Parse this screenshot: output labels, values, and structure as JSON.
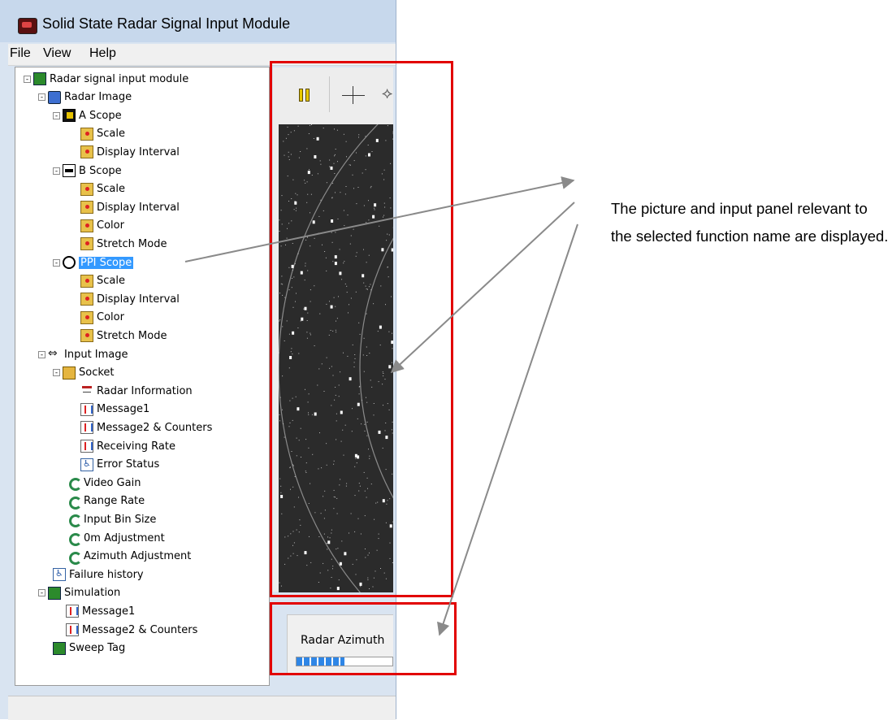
{
  "window": {
    "title": "Solid State Radar Signal Input Module"
  },
  "menu": [
    "File",
    "View",
    "Help"
  ],
  "tree": [
    {
      "label": "Radar signal input module",
      "icon": "module-icon",
      "expander": "-"
    },
    {
      "label": "Radar Image",
      "icon": "monitor-icon",
      "expander": "-"
    },
    {
      "label": "A Scope",
      "icon": "a-scope-icon",
      "expander": "-"
    },
    {
      "label": "Scale",
      "icon": "folder-icon"
    },
    {
      "label": "Display Interval",
      "icon": "folder-icon"
    },
    {
      "label": "B Scope",
      "icon": "b-scope-icon",
      "expander": "-"
    },
    {
      "label": "Scale",
      "icon": "folder-icon"
    },
    {
      "label": "Display Interval",
      "icon": "folder-icon"
    },
    {
      "label": "Color",
      "icon": "folder-icon"
    },
    {
      "label": "Stretch Mode",
      "icon": "folder-icon"
    },
    {
      "label": "PPI Scope",
      "icon": "ppi-scope-icon",
      "expander": "-",
      "selected": true
    },
    {
      "label": "Scale",
      "icon": "folder-icon"
    },
    {
      "label": "Display Interval",
      "icon": "folder-icon"
    },
    {
      "label": "Color",
      "icon": "folder-icon"
    },
    {
      "label": "Stretch Mode",
      "icon": "folder-icon"
    },
    {
      "label": "Input Image",
      "icon": "usb-icon",
      "expander": "-"
    },
    {
      "label": "Socket",
      "icon": "socket-icon",
      "expander": "-"
    },
    {
      "label": "Radar Information",
      "icon": "antenna-icon"
    },
    {
      "label": "Message1",
      "icon": "message-icon"
    },
    {
      "label": "Message2 & Counters",
      "icon": "message-icon"
    },
    {
      "label": "Receiving Rate",
      "icon": "message-icon"
    },
    {
      "label": "Error Status",
      "icon": "accessibility-icon"
    },
    {
      "label": "Video Gain",
      "icon": "wrench-icon"
    },
    {
      "label": "Range Rate",
      "icon": "wrench-icon"
    },
    {
      "label": "Input Bin Size",
      "icon": "wrench-icon"
    },
    {
      "label": "0m Adjustment",
      "icon": "wrench-icon"
    },
    {
      "label": "Azimuth Adjustment",
      "icon": "wrench-icon"
    },
    {
      "label": "Failure history",
      "icon": "accessibility-icon"
    },
    {
      "label": "Simulation",
      "icon": "module-icon",
      "expander": "-"
    },
    {
      "label": "Message1",
      "icon": "message-icon"
    },
    {
      "label": "Message2 & Counters",
      "icon": "message-icon"
    },
    {
      "label": "Sweep Tag",
      "icon": "module-icon"
    }
  ],
  "toolbar": {
    "icons": [
      "pause-icon",
      "crosshair-icon",
      "move-icon"
    ]
  },
  "input_panel": {
    "label": "Radar Azimuth",
    "progress_percent": 50
  },
  "annotation": {
    "text": "The picture and input panel relevant to the selected function name are displayed."
  },
  "colors": {
    "highlight_box": "#e20000",
    "selection": "#3399ff"
  }
}
